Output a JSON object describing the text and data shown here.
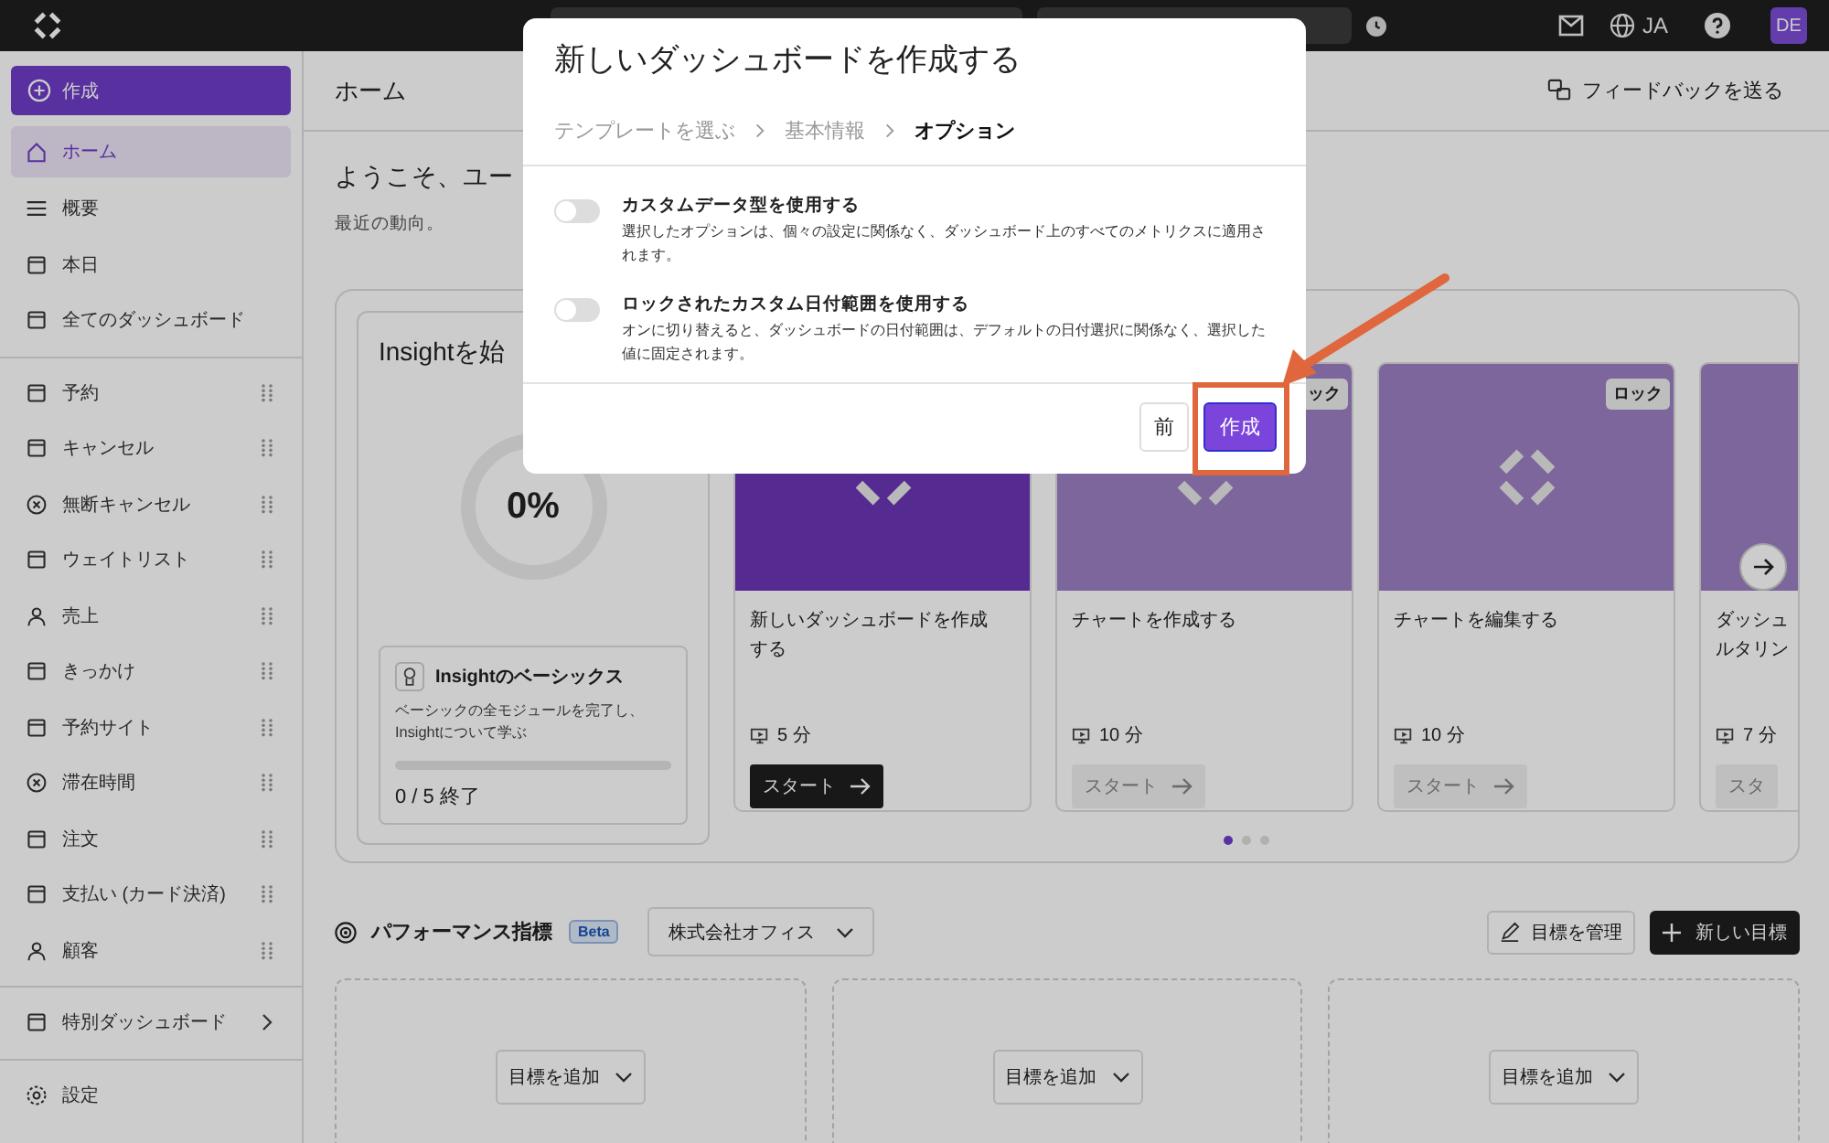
{
  "topbar": {
    "language": "JA",
    "user_initials": "DE"
  },
  "sidebar": {
    "create_button": "作成",
    "sections": [
      {
        "items": [
          {
            "label": "ホーム",
            "selected": true,
            "kind": "fixed"
          },
          {
            "label": "概要",
            "selected": false,
            "kind": "fixed"
          },
          {
            "label": "本日",
            "selected": false,
            "kind": "fixed"
          },
          {
            "label": "全てのダッシュボード",
            "selected": false,
            "kind": "fixed"
          }
        ]
      },
      {
        "items": [
          {
            "label": "予約",
            "selected": false,
            "kind": "draggable"
          },
          {
            "label": "キャンセル",
            "selected": false,
            "kind": "draggable"
          },
          {
            "label": "無断キャンセル",
            "selected": false,
            "kind": "draggable"
          },
          {
            "label": "ウェイトリスト",
            "selected": false,
            "kind": "draggable"
          },
          {
            "label": "売上",
            "selected": false,
            "kind": "draggable"
          },
          {
            "label": "きっかけ",
            "selected": false,
            "kind": "draggable"
          },
          {
            "label": "予約サイト",
            "selected": false,
            "kind": "draggable"
          },
          {
            "label": "滞在時間",
            "selected": false,
            "kind": "draggable"
          },
          {
            "label": "注文",
            "selected": false,
            "kind": "draggable"
          },
          {
            "label": "支払い (カード決済)",
            "selected": false,
            "kind": "draggable"
          },
          {
            "label": "顧客",
            "selected": false,
            "kind": "draggable"
          }
        ]
      },
      {
        "items": [
          {
            "label": "特別ダッシュボード",
            "selected": false,
            "kind": "submenu"
          }
        ]
      },
      {
        "items": [
          {
            "label": "設定",
            "selected": false,
            "kind": "fixed"
          }
        ]
      }
    ]
  },
  "header": {
    "title": "ホーム",
    "feedback_button": "フィードバックを送る"
  },
  "welcome": {
    "heading": "ようこそ、ユー",
    "subtitle": "最近の動向。"
  },
  "insight": {
    "title": "Insightを始",
    "progress": "0%",
    "basics": {
      "title": "Insightのベーシックス",
      "description": "ベーシックの全モジュールを完了し、Insightについて学ぶ",
      "level": 0,
      "count": "0 / 5 終了"
    },
    "tutorials": [
      {
        "title": "新しいダッシュボードを作成する",
        "duration": "5 分",
        "start_button": "スタート",
        "arrow": true,
        "locked": false
      },
      {
        "title": "チャートを作成する",
        "duration": "10 分",
        "start_button": "スタート",
        "arrow": true,
        "locked": true,
        "badge": "ック"
      },
      {
        "title": "チャートを編集する",
        "duration": "10 分",
        "start_button": "スタート",
        "arrow": true,
        "locked": true,
        "badge": "ロック"
      },
      {
        "title": "ダッシュ",
        "title_continued": "ルタリン",
        "duration": "7 分",
        "start_button": "スタ",
        "arrow": false,
        "locked": true
      }
    ],
    "pages": [
      {
        "selected": true
      },
      {
        "selected": false
      },
      {
        "selected": false
      }
    ]
  },
  "performance": {
    "title": "パフォーマンス指標",
    "badge": "Beta",
    "location_select": "株式会社オフィス",
    "manage_button": "目標を管理",
    "new_button": "新しい目標",
    "slots": [
      {
        "button": "目標を追加"
      },
      {
        "button": "目標を追加"
      },
      {
        "button": "目標を追加"
      }
    ]
  },
  "dialog": {
    "title": "新しいダッシュボードを作成する",
    "steps": [
      {
        "label": "テンプレートを選ぶ",
        "selected": false
      },
      {
        "label": "基本情報",
        "selected": false
      },
      {
        "label": "オプション",
        "selected": true
      }
    ],
    "options": [
      {
        "title": "カスタムデータ型を使用する",
        "description": "選択したオプションは、個々の設定に関係なく、ダッシュボード上のすべてのメトリクスに適用されます。",
        "on": false
      },
      {
        "title": "ロックされたカスタム日付範囲を使用する",
        "description": "オンに切り替えると、ダッシュボードの日付範囲は、デフォルトの日付選択に関係なく、選択した値に固定されます。",
        "on": false
      }
    ],
    "back_button": "前",
    "create_button": "作成"
  }
}
